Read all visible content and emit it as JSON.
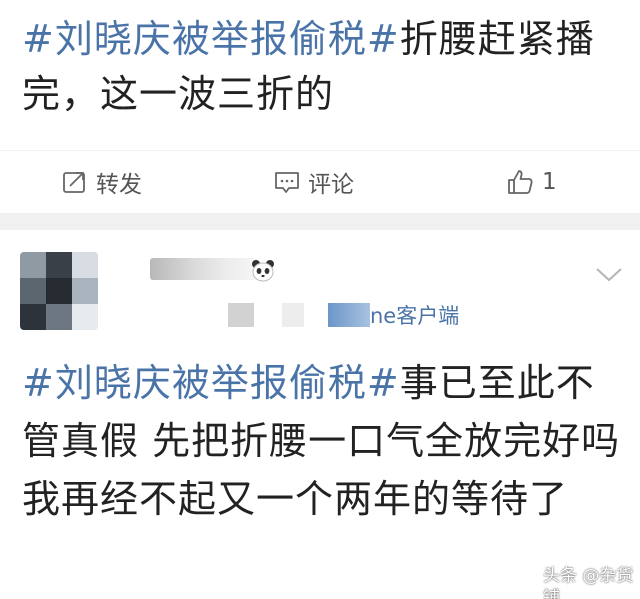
{
  "post1": {
    "hashtag": "#刘晓庆被举报偷税#",
    "text": "折腰赶紧播完，这一波三折的"
  },
  "actions": {
    "repost_label": "转发",
    "comment_label": "评论",
    "like_count": "1"
  },
  "post2": {
    "client_label": "ne客户端",
    "hashtag": "#刘晓庆被举报偷税#",
    "text": "事已至此不管真假 先把折腰一口气全放完好吗 我再经不起又一个两年的等待了"
  },
  "watermark": "头条 @杂货铺",
  "colors": {
    "hashtag": "#4a74a8",
    "text": "#222222",
    "divider": "#f0f0f0"
  },
  "icons": {
    "repost": "repost-icon",
    "comment": "comment-icon",
    "like": "thumbs-up-icon",
    "menu": "chevron-down-icon",
    "badge": "panda-icon"
  }
}
